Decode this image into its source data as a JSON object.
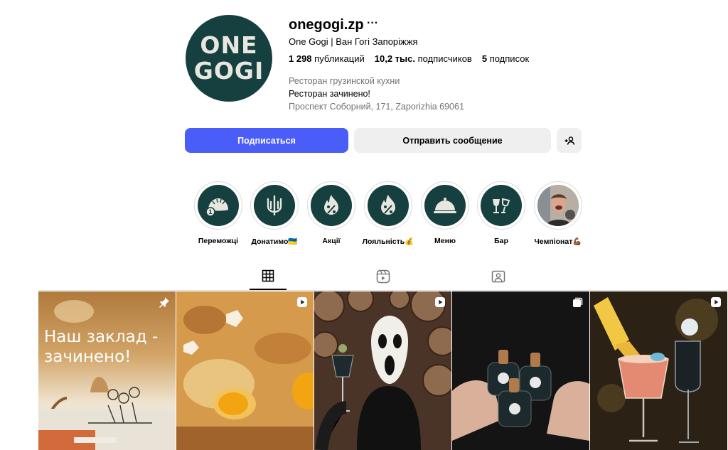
{
  "profile": {
    "avatar_text_line1": "ONE",
    "avatar_text_line2": "GOGI",
    "username": "onegogi.zp",
    "more": "···",
    "full_name": "One Gogi | Ван Гогі Запоріжжя",
    "posts_count": "1 298",
    "posts_label": "публикаций",
    "followers_count": "10,2 тыс.",
    "followers_label": "подписчиков",
    "following_count": "5",
    "following_label": "подписок",
    "category": "Ресторан грузинской кухни",
    "bio": "Ресторан зачинено!",
    "address": "Проспект Соборний, 171, Zaporizhia 69061"
  },
  "actions": {
    "follow": "Подписаться",
    "message": "Отправить сообщение",
    "suggest_icon": "add-person-icon"
  },
  "highlights": [
    {
      "label": "Переможці",
      "icon": "dumpling-medal-icon"
    },
    {
      "label": "Донатимо🇺🇦",
      "icon": "trident-icon"
    },
    {
      "label": "Акції",
      "icon": "fire-percent-icon"
    },
    {
      "label": "Лояльність💰",
      "icon": "fire-percent-icon"
    },
    {
      "label": "Меню",
      "icon": "cloche-icon"
    },
    {
      "label": "Бар",
      "icon": "wine-glasses-icon"
    },
    {
      "label": "Чемпіонат💪🏾",
      "icon": "photo-person-icon"
    }
  ],
  "tabs": [
    {
      "name": "posts",
      "icon": "grid-icon",
      "active": true
    },
    {
      "name": "reels",
      "icon": "reels-icon",
      "active": false
    },
    {
      "name": "tagged",
      "icon": "tagged-icon",
      "active": false
    }
  ],
  "posts": [
    {
      "caption": "Наш заклад - зачинено!",
      "badge": "pin-icon"
    },
    {
      "caption": "",
      "badge": "reel-icon"
    },
    {
      "caption": "",
      "badge": "reel-icon"
    },
    {
      "caption": "",
      "badge": "carousel-icon"
    },
    {
      "caption": "",
      "badge": "reel-icon"
    }
  ],
  "colors": {
    "brand": "#15403f",
    "follow_button": "#4a5df9",
    "secondary_button": "#efefef",
    "muted_text": "#737373"
  }
}
